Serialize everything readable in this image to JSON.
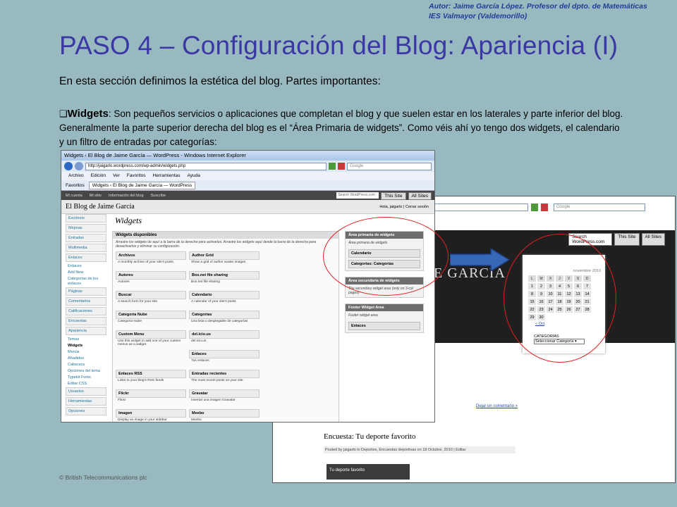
{
  "slide": {
    "author_line1": "Autor: Jaime García López. Profesor del dpto. de Matemáticas",
    "author_line2": "IES Valmayor (Valdemorillo)",
    "title": "PASO 4 – Configuración del Blog: Apariencia (I)",
    "intro": "En esta sección definimos la estética del blog. Partes importantes:",
    "bullet_glyph": "❑",
    "widgets_label": "Widgets",
    "widgets_text": ": Son pequeños servicios o aplicaciones que completan el blog y que suelen estar en los laterales y parte inferior del blog. Generalmente la parte superior derecha del blog es el “Área Primaria de widgets”. Como véis ahí yo tengo dos widgets, el calendario y un filtro de entradas por categorías:",
    "copyright": "© British Telecommunications plc",
    "accent_color": "#3b38a6",
    "annotation_color": "#e02020"
  },
  "ie_window": {
    "title": "Widgets ‹ El Blog de Jaime García — WordPress - Windows Internet Explorer",
    "address": "http://jaigarlo.wordpress.com/wp-admin/widgets.php",
    "search_placeholder": "Google",
    "menu": [
      "Archivo",
      "Edición",
      "Ver",
      "Favoritos",
      "Herramientas",
      "Ayuda"
    ],
    "favorites_label": "Favoritos",
    "tab_label": "Widgets ‹ El Blog de Jaime García — WordPress",
    "admin_bar": [
      "Mi cuenta",
      "Mi sitio",
      "Información del blog",
      "Suscribe"
    ],
    "admin_search": "Search WordPress.com",
    "this_site": "This Site",
    "all_sites": "All Sites"
  },
  "wp_admin": {
    "blog_name": "El Blog de Jaime García",
    "greeting": "Hola, jaigarlo | Cerrar sesión",
    "page_title": "Widgets",
    "sidebar": [
      {
        "label": "Escritorio",
        "subs": []
      },
      {
        "label": "Mejoras",
        "subs": []
      },
      {
        "label": "Entradas",
        "subs": []
      },
      {
        "label": "Multimedia",
        "subs": []
      },
      {
        "label": "Enlaces",
        "subs": [
          "Enlaces",
          "Add New",
          "Categorías de los enlaces"
        ]
      },
      {
        "label": "Páginas",
        "subs": []
      },
      {
        "label": "Comentarios",
        "subs": []
      },
      {
        "label": "Calificaciones",
        "subs": []
      },
      {
        "label": "Encuestas",
        "subs": []
      },
      {
        "label": "Apariencia",
        "subs": [
          "Temas",
          "Widgets",
          "Menús",
          "Añadidos",
          "Cabecera",
          "Opciones del tema",
          "Typekit Fonts",
          "Editar CSS"
        ]
      },
      {
        "label": "Usuarios",
        "subs": []
      },
      {
        "label": "Herramientas",
        "subs": []
      },
      {
        "label": "Opciones",
        "subs": []
      }
    ],
    "available_header": "Widgets disponibles",
    "available_desc": "Arrastre los widgets de aquí a la barra de la derecha para activarlos. Arrastre los widgets aquí desde la barra de la derecha para desactivarlos y eliminar su configuración.",
    "widgets": [
      {
        "name": "Archivos",
        "desc": "A monthly archive of your site's posts"
      },
      {
        "name": "Author Grid",
        "desc": "Show a grid of author avatar images."
      },
      {
        "name": "Autores",
        "desc": "Autores"
      },
      {
        "name": "Box.net file sharing",
        "desc": "Box.net file sharing"
      },
      {
        "name": "Buscar",
        "desc": "A search form for your site"
      },
      {
        "name": "Calendario",
        "desc": "A calendar of your site's posts"
      },
      {
        "name": "Categoría Nube",
        "desc": "Categoría Nube"
      },
      {
        "name": "Categorías",
        "desc": "Una lista o desplegable de categorías"
      },
      {
        "name": "Custom Menu",
        "desc": "Use this widget to add one of your custom menus as a widget."
      },
      {
        "name": "del.icio.us",
        "desc": "del.icio.us"
      },
      {
        "name": "",
        "desc": ""
      },
      {
        "name": "Enlaces",
        "desc": "Tus enlaces"
      },
      {
        "name": "Enlaces RSS",
        "desc": "Links to your blog's RSS feeds"
      },
      {
        "name": "Entradas recientes",
        "desc": "The most recent posts on your site"
      },
      {
        "name": "Flickr",
        "desc": "Flickr"
      },
      {
        "name": "Gravatar",
        "desc": "Insertar una imagen Gravatar"
      },
      {
        "name": "Imagen",
        "desc": "Display an image in your sidebar"
      },
      {
        "name": "Meebo",
        "desc": "Meebo"
      }
    ],
    "areas": [
      {
        "name": "Área primaria de widgets",
        "desc": "Área primaria de widgets",
        "items": [
          "Calendario",
          "Categorías: Categorías"
        ]
      },
      {
        "name": "Área secundaria de widgets",
        "desc": "The secondary widget area (only on 3-col pages)",
        "items": []
      },
      {
        "name": "Footer Widget Area",
        "desc": "Footer widget area",
        "items": [
          "Enlaces"
        ]
      }
    ]
  },
  "blog_window": {
    "search_placeholder": "Google",
    "admin_search": "Search WordPress.com",
    "this_site": "This Site",
    "all_sites": "All Sites",
    "blog_name_fragment": "E GARCÍA",
    "comment_link": "Dejar un comentario »",
    "post_title": "Encuesta: Tu deporte favorito",
    "post_meta": "Posted by jaigarlo in Deportes, Encuestas deportivas on 18 Octubre, 2010 | Editar",
    "poll_title": "Tu deporte favorito"
  },
  "calendar": {
    "month": "noviembre 2010",
    "weekdays": [
      "L",
      "M",
      "X",
      "J",
      "V",
      "S",
      "D"
    ],
    "weeks": [
      [
        "1",
        "2",
        "3",
        "4",
        "5",
        "6",
        "7"
      ],
      [
        "8",
        "9",
        "10",
        "11",
        "12",
        "13",
        "14"
      ],
      [
        "15",
        "16",
        "17",
        "18",
        "19",
        "20",
        "21"
      ],
      [
        "22",
        "23",
        "24",
        "25",
        "26",
        "27",
        "28"
      ],
      [
        "29",
        "30",
        "",
        "",
        "",
        "",
        ""
      ]
    ],
    "prev_link": "« Oct",
    "categories_label": "CATEGORÍAS",
    "categories_select": "Seleccionar Categoría"
  }
}
